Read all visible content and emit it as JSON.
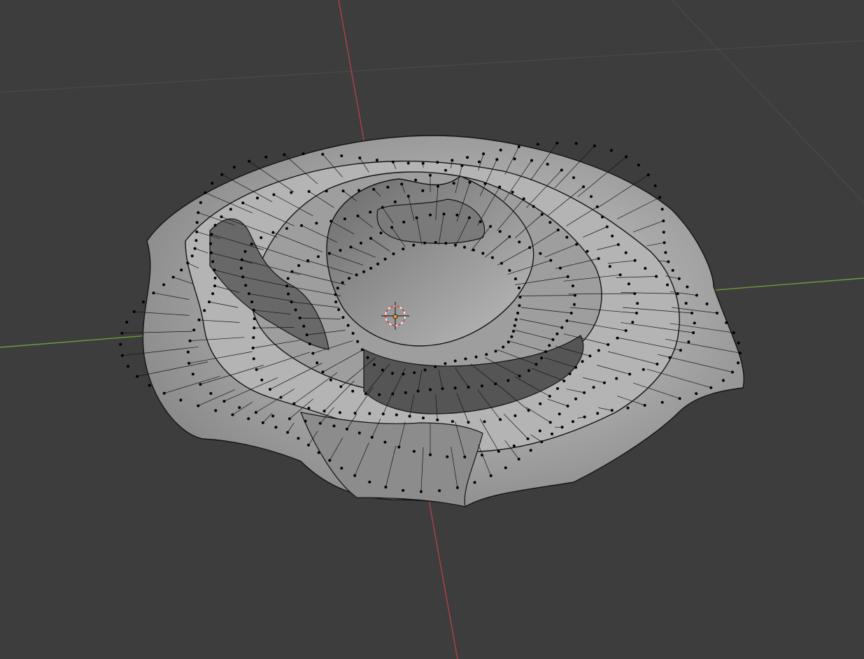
{
  "viewport": {
    "background": "#3d3d3d",
    "grid_color": "#4a4a4a",
    "x_axis_color": "#b0404a",
    "y_axis_color": "#6f9a3a",
    "mesh_face_color": "#a9a9a9",
    "mesh_shadow_color": "#5a5a5a",
    "mesh_light_color": "#c8c8c8",
    "wire_color": "#141414",
    "vertex_color": "#000000",
    "cursor_color": "#e23b3b",
    "origin_color": "#f0a020"
  },
  "icons": {
    "cursor": "3d-cursor-icon",
    "origin": "object-origin-icon"
  }
}
